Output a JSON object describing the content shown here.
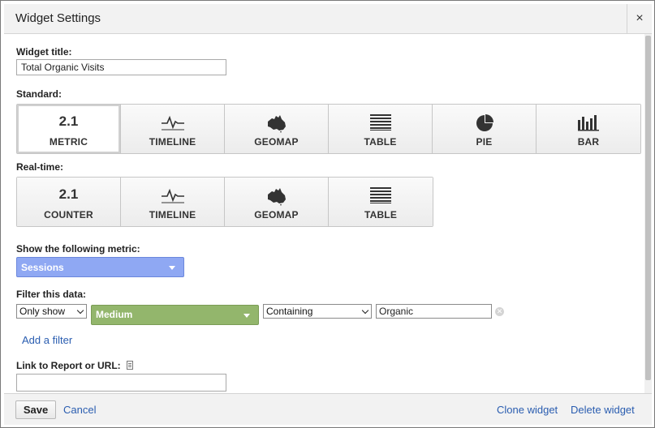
{
  "dialog": {
    "title": "Widget Settings",
    "close_glyph": "×"
  },
  "widget_title": {
    "label": "Widget title:",
    "value": "Total Organic Visits"
  },
  "standard": {
    "label": "Standard:",
    "buttons": [
      {
        "label": "METRIC",
        "icon": "metric-number-icon",
        "icon_text": "2.1",
        "active": true
      },
      {
        "label": "TIMELINE",
        "icon": "timeline-icon"
      },
      {
        "label": "GEOMAP",
        "icon": "australia-map-icon"
      },
      {
        "label": "TABLE",
        "icon": "table-icon"
      },
      {
        "label": "PIE",
        "icon": "pie-chart-icon"
      },
      {
        "label": "BAR",
        "icon": "bar-chart-icon"
      }
    ]
  },
  "realtime": {
    "label": "Real-time:",
    "buttons": [
      {
        "label": "COUNTER",
        "icon": "counter-number-icon",
        "icon_text": "2.1"
      },
      {
        "label": "TIMELINE",
        "icon": "timeline-icon"
      },
      {
        "label": "GEOMAP",
        "icon": "australia-map-icon"
      },
      {
        "label": "TABLE",
        "icon": "table-icon"
      }
    ]
  },
  "metric": {
    "label": "Show the following metric:",
    "selected": "Sessions",
    "color": "#8fa8f3"
  },
  "filter": {
    "label": "Filter this data:",
    "mode": "Only show",
    "dimension": "Medium",
    "dimension_color": "#93b66c",
    "operator": "Containing",
    "value": "Organic",
    "add_label": "Add a filter"
  },
  "link": {
    "label": "Link to Report or URL:",
    "value": ""
  },
  "footer": {
    "save": "Save",
    "cancel": "Cancel",
    "clone": "Clone widget",
    "delete": "Delete widget"
  }
}
